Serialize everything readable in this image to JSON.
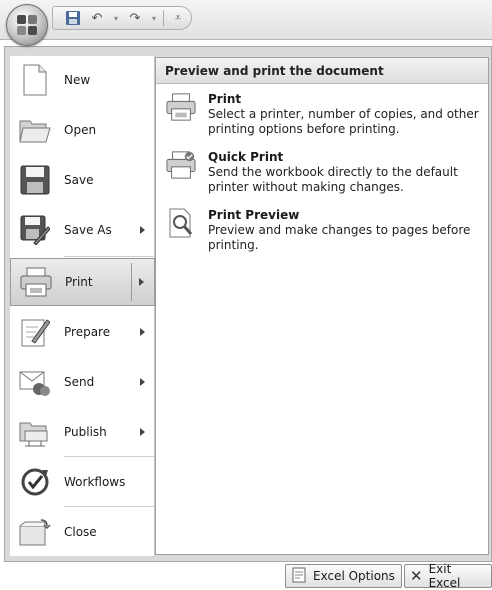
{
  "quick_access": {
    "items": [
      "save-icon",
      "undo-icon",
      "redo-icon",
      "customize-icon"
    ]
  },
  "menu": {
    "items": [
      {
        "label": "New",
        "icon": "new-document-icon",
        "has_submenu": false
      },
      {
        "label": "Open",
        "icon": "open-folder-icon",
        "has_submenu": false
      },
      {
        "label": "Save",
        "icon": "save-icon",
        "has_submenu": false
      },
      {
        "label": "Save As",
        "icon": "save-as-icon",
        "has_submenu": true
      },
      {
        "label": "Print",
        "icon": "printer-icon",
        "has_submenu": true,
        "selected": true
      },
      {
        "label": "Prepare",
        "icon": "prepare-icon",
        "has_submenu": true
      },
      {
        "label": "Send",
        "icon": "send-icon",
        "has_submenu": true
      },
      {
        "label": "Publish",
        "icon": "publish-icon",
        "has_submenu": true
      },
      {
        "label": "Workflows",
        "icon": "workflows-icon",
        "has_submenu": false
      },
      {
        "label": "Close",
        "icon": "close-folder-icon",
        "has_submenu": false
      }
    ]
  },
  "submenu": {
    "header": "Preview and print the document",
    "items": [
      {
        "title": "Print",
        "description": "Select a printer, number of copies, and other printing options before printing.",
        "icon": "printer-icon"
      },
      {
        "title": "Quick Print",
        "description": "Send the workbook directly to the default printer without making changes.",
        "icon": "quick-print-icon"
      },
      {
        "title": "Print Preview",
        "description": "Preview and make changes to pages before printing.",
        "icon": "print-preview-icon"
      }
    ]
  },
  "bottom": {
    "options_label": "Excel Options",
    "exit_label": "Exit Excel"
  }
}
